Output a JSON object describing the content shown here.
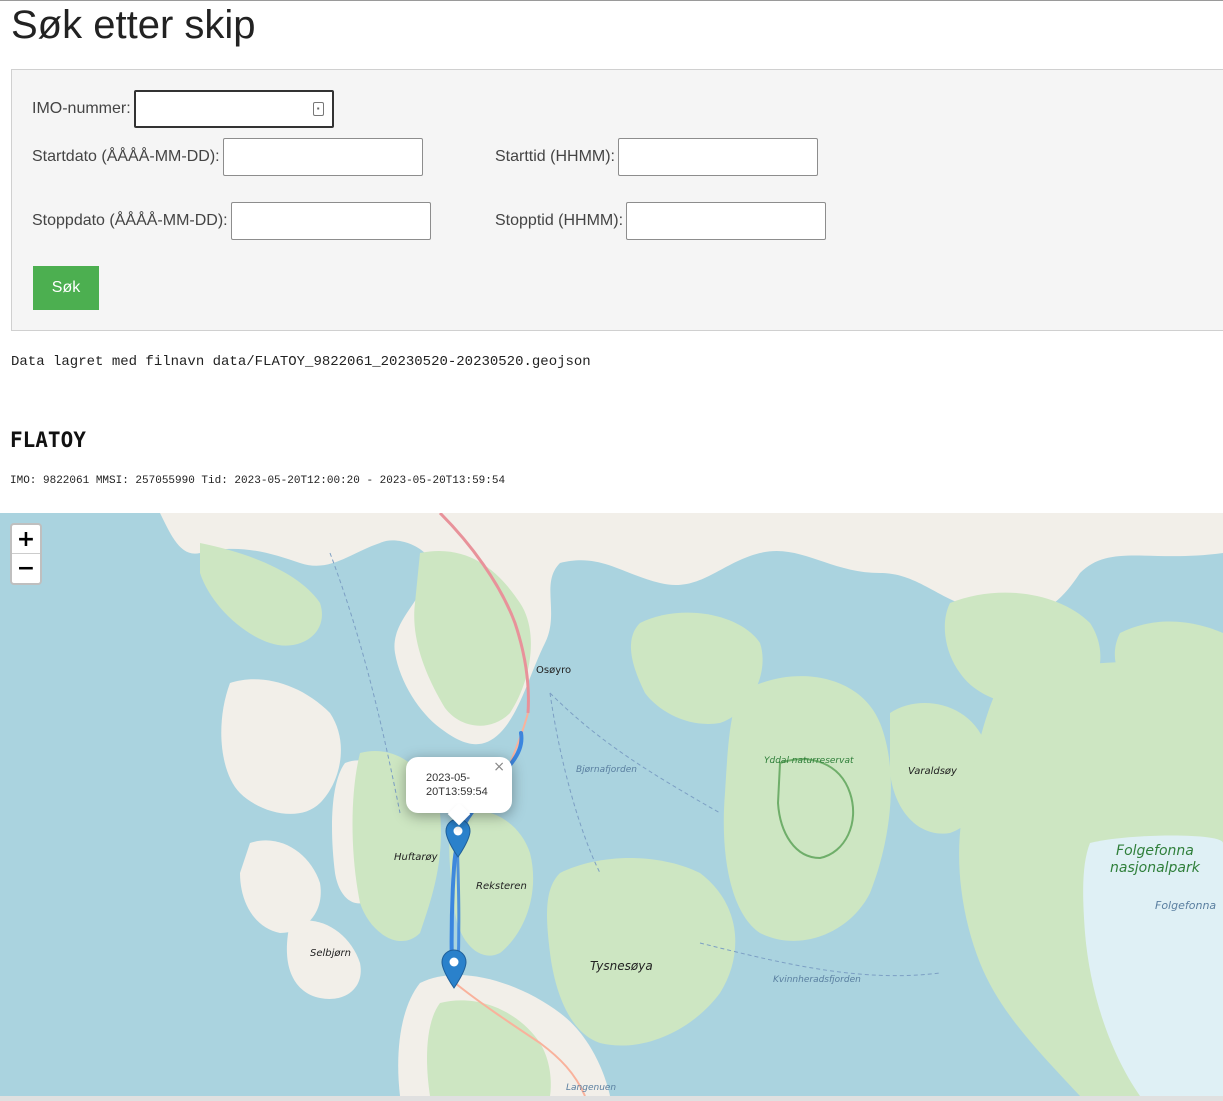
{
  "page": {
    "title": "Søk etter skip"
  },
  "form": {
    "imo_label": "IMO-nummer:",
    "imo_value": "",
    "startdate_label": "Startdato (ÅÅÅÅ-MM-DD):",
    "startdate_value": "",
    "starttime_label": "Starttid (HHMM):",
    "starttime_value": "",
    "stopdate_label": "Stoppdato (ÅÅÅÅ-MM-DD):",
    "stopdate_value": "",
    "stoptime_label": "Stopptid (HHMM):",
    "stoptime_value": "",
    "search_label": "Søk",
    "search_color": "#4caf50"
  },
  "result": {
    "saved_message": "Data lagret med filnavn data/FLATOY_9822061_20230520-20230520.geojson",
    "ship_name": "FLATOY",
    "ship_info": "IMO: 9822061 MMSI: 257055990 Tid: 2023-05-20T12:00:20 - 2023-05-20T13:59:54"
  },
  "map": {
    "zoom_in": "+",
    "zoom_out": "−",
    "popup": {
      "line1": "2023-05-",
      "line2": "20T13:59:54",
      "close": "×"
    },
    "labels": {
      "osoyro": "Osøyro",
      "bjornafjorden": "Bjørnafjorden",
      "yddal": "Yddal naturreservat",
      "varaldsoy": "Varaldsøy",
      "huftaroy": "Huftarøy",
      "reksteren": "Reksteren",
      "selbjorn": "Selbjørn",
      "tysnesoya": "Tysnesøya",
      "kvinnheradsfjorden": "Kvinnheradsfjorden",
      "folgefonna_park_1": "Folgefonna",
      "folgefonna_park_2": "nasjonalpark",
      "folgefonna": "Folgefonna",
      "langenuen": "Langenuen"
    },
    "colors": {
      "water": "#aad3df",
      "land": "#f2efe9",
      "forest": "#c8e3bd",
      "track": "#2f7ddf",
      "marker": "#2a81cb"
    }
  }
}
